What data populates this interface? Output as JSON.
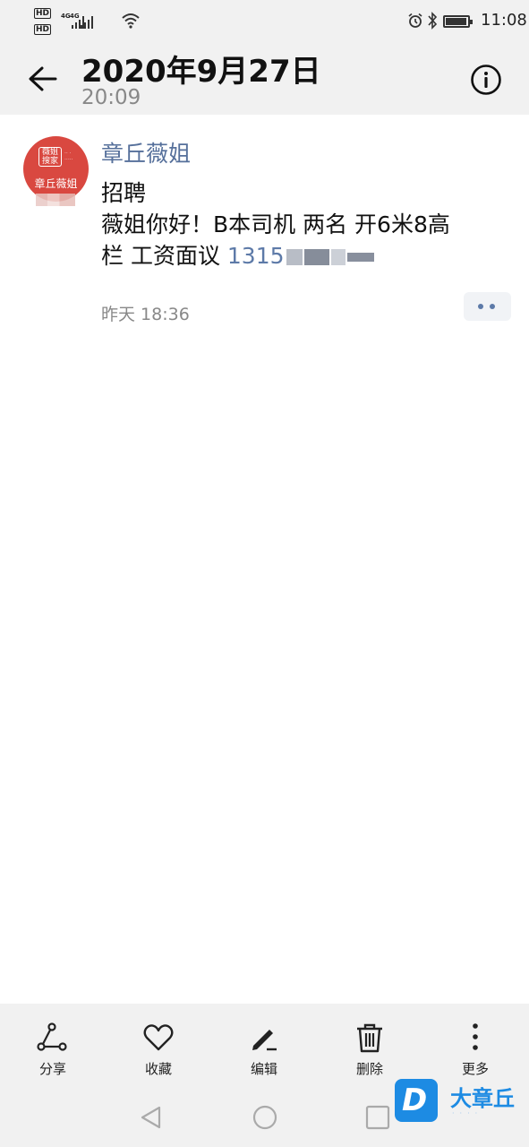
{
  "status_bar": {
    "hd_1": "HD",
    "hd_2": "HD",
    "net_1": "4G",
    "net_2": "4G",
    "battery_level": 0.95,
    "time": "11:08"
  },
  "header": {
    "title": "2020年9月27日",
    "subtitle": "20:09",
    "back_icon": "arrow-left-icon",
    "info_icon": "info-circle-icon"
  },
  "post": {
    "avatar_top": "薇姐\n搜家",
    "avatar_bottom": "章丘薇姐",
    "sender": "章丘薇姐",
    "message_lines": [
      "招聘",
      "薇姐你好！B本司机  两名  开6米8高",
      "栏  工资面议 "
    ],
    "phone": "1315",
    "timestamp": "昨天 18:36"
  },
  "toolbar": {
    "items": [
      {
        "label": "分享",
        "icon": "share-icon"
      },
      {
        "label": "收藏",
        "icon": "heart-icon"
      },
      {
        "label": "编辑",
        "icon": "pen-icon"
      },
      {
        "label": "删除",
        "icon": "trash-icon"
      },
      {
        "label": "更多",
        "icon": "more-vertical-icon"
      }
    ]
  },
  "navbar": {
    "back": "triangle-back-icon",
    "home": "circle-home-icon",
    "recent": "square-recent-icon"
  },
  "watermark": {
    "logo_letter": "D",
    "brand": "大章丘"
  },
  "colors": {
    "accent_blue": "#5d7aa8",
    "avatar_red": "#d94840",
    "bar_bg": "#f1f1f1"
  }
}
